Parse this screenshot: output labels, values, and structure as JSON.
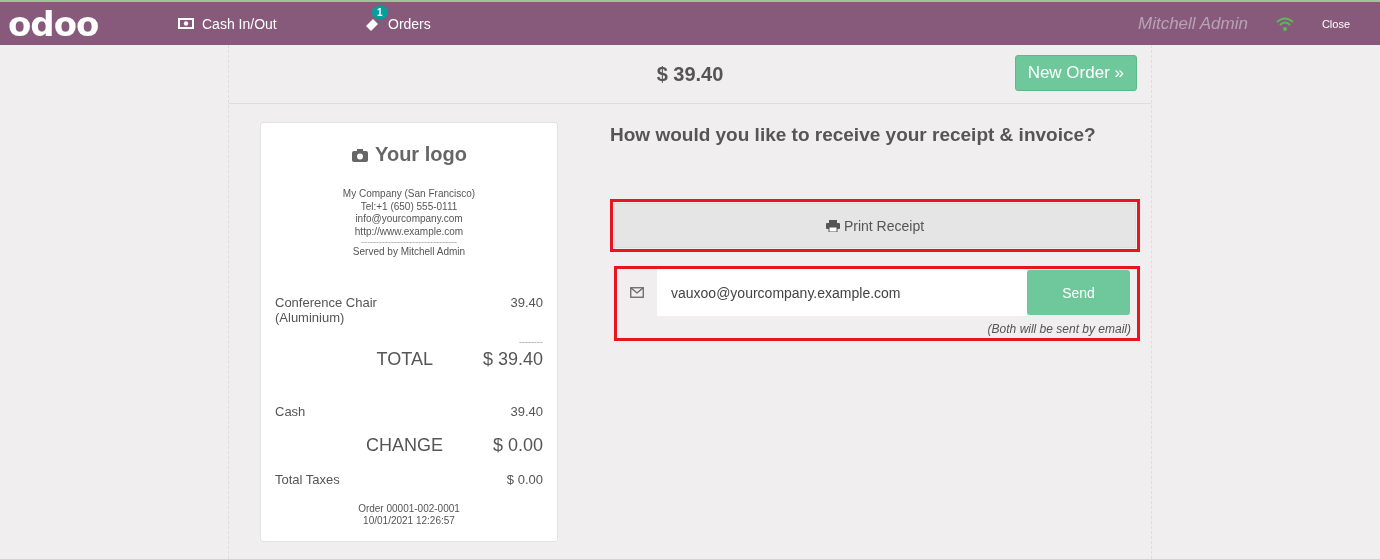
{
  "header": {
    "logo": "odoo",
    "cash_button": "Cash In/Out",
    "orders_button": "Orders",
    "orders_badge": "1",
    "user": "Mitchell Admin",
    "close": "Close"
  },
  "top": {
    "amount": "$ 39.40",
    "new_order": "New Order »"
  },
  "receipt": {
    "logo_text": "Your logo",
    "company_lines": [
      "My Company (San Francisco)",
      "Tel:+1 (650) 555-0111",
      "info@yourcompany.com",
      "http://www.example.com"
    ],
    "divider": "--------------------------------",
    "served_by": "Served by Mitchell Admin",
    "lines": [
      {
        "name": "Conference Chair (Aluminium)",
        "price": "39.40"
      }
    ],
    "sum_divider": "--------",
    "total_label": "TOTAL",
    "total": "$ 39.40",
    "payments": [
      {
        "name": "Cash",
        "amount": "39.40"
      }
    ],
    "change_label": "CHANGE",
    "change": "$ 0.00",
    "taxes_label": "Total Taxes",
    "taxes": "$ 0.00",
    "order": "Order 00001-002-0001",
    "date": "10/01/2021 12:26:57"
  },
  "screen": {
    "question": "How would you like to receive your receipt & invoice?",
    "print_button": "Print Receipt",
    "email": {
      "value": "vauxoo@yourcompany.example.com"
    },
    "send_button": "Send",
    "note": "(Both will be sent by email)"
  }
}
